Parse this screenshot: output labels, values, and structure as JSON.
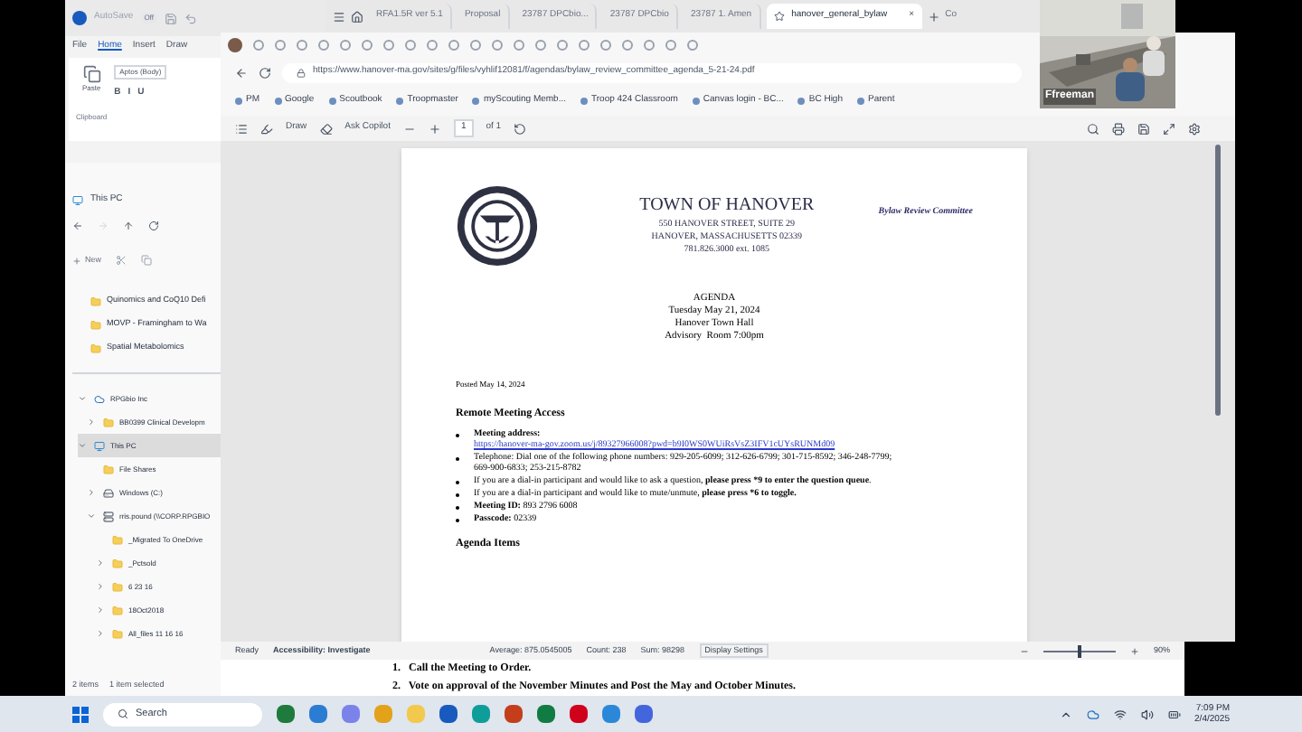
{
  "word": {
    "autosave": "AutoSave",
    "autosave_state": "Off",
    "ribbon_tabs": [
      {
        "label": "File",
        "selected": false
      },
      {
        "label": "Home",
        "selected": true
      },
      {
        "label": "Insert",
        "selected": false
      },
      {
        "label": "Draw",
        "selected": false
      }
    ],
    "paste": "Paste",
    "font": "Aptos (Body)",
    "format_buttons": [
      "B",
      "I",
      "U"
    ],
    "group": "Clipboard"
  },
  "browser": {
    "tabs": [
      {
        "label": "RFA1.5R ver 5.1",
        "selected": false
      },
      {
        "label": "Proposal",
        "selected": false
      },
      {
        "label": "23787 DPCbio...",
        "selected": false
      },
      {
        "label": "23787 DPCbio",
        "selected": false
      },
      {
        "label": "23787 1. Amen",
        "selected": false
      },
      {
        "label": "hanover_general_bylaw",
        "selected": true
      }
    ],
    "close": "×",
    "new_tab_label": "Co",
    "url": "https://www.hanover-ma.gov/sites/g/files/vyhlif12081/f/agendas/bylaw_review_committee_agenda_5-21-24.pdf",
    "bookmarks": [
      "PM",
      "Google",
      "Scoutbook",
      "Troopmaster",
      "myScouting Memb...",
      "Troop 424 Classroom",
      "Canvas login - BC...",
      "BC High",
      "Parent"
    ],
    "pdf_toolbar": {
      "draw": "Draw",
      "copilot": "Ask Copilot",
      "page": "1",
      "of": "of 1"
    }
  },
  "video": {
    "name": "Ffreeman"
  },
  "pdf": {
    "title": "TOWN OF HANOVER",
    "address": [
      "550 HANOVER STREET, SUITE 29",
      "HANOVER, MASSACHUSETTS 02339",
      "781.826.3000 ext. 1085"
    ],
    "committee": "Bylaw Review Committee",
    "agenda": [
      "AGENDA",
      "Tuesday May 21, 2024",
      "Hanover Town Hall",
      "Advisory  Room 7:00pm"
    ],
    "posted": "Posted May 14, 2024",
    "section": "Remote Meeting Access",
    "bullets": [
      {
        "kind": "link",
        "label": "Meeting address:",
        "link": "https://hanover-ma-gov.zoom.us/j/89327966008?pwd=b9I0WS0WUiRsVsZ3IFV1cUYsRUNMd09"
      },
      {
        "kind": "text",
        "text": "Telephone: Dial one of the following phone numbers: 929-205-6099; 312-626-6799; 301-715-8592; 346-248-7799; 669-900-6833; 253-215-8782"
      },
      {
        "kind": "text",
        "text": "If you are a dial-in participant and would like to ask a question, **please press *9 to enter the question queue**."
      },
      {
        "kind": "text",
        "text": "If you are a dial-in participant and would like to mute/unmute, **please press *6 to toggle.**"
      },
      {
        "kind": "text",
        "text": "**Meeting ID:** 893 2796 6008"
      },
      {
        "kind": "text",
        "text": "**Passcode:** 02339"
      }
    ],
    "items_heading": "Agenda Items"
  },
  "explorer": {
    "title": "This PC",
    "new": "New",
    "quick": [
      "Quinomics and CoQ10 Defi",
      "MOVP - Framingham to Wa",
      "Spatial Metabolomics"
    ],
    "tree": [
      {
        "label": "RPGbio Inc",
        "kind": "cloud",
        "expanded": true,
        "selected": false,
        "children": [
          {
            "label": "BB0399 Clinical Developm",
            "kind": "folder",
            "expanded": false,
            "selected": false
          }
        ]
      },
      {
        "label": "This PC",
        "kind": "pc",
        "expanded": true,
        "selected": true,
        "children": [
          {
            "label": "File Shares",
            "kind": "folder",
            "selected": false
          },
          {
            "label": "Windows (C:)",
            "kind": "drive",
            "expanded": false,
            "selected": false
          },
          {
            "label": "rris.pound (\\\\CORP.RPGBIO",
            "kind": "network",
            "expanded": true,
            "selected": false,
            "children": [
              {
                "label": "_Migrated To OneDrive",
                "kind": "folder",
                "selected": false
              },
              {
                "label": "_Pctsold",
                "kind": "folder",
                "expanded": false,
                "selected": false
              },
              {
                "label": "6 23 16",
                "kind": "folder",
                "expanded": false,
                "selected": false
              },
              {
                "label": "18Oct2018",
                "kind": "folder",
                "expanded": false,
                "selected": false
              },
              {
                "label": "All_files 11 16 16",
                "kind": "folder",
                "expanded": false,
                "selected": false
              }
            ]
          }
        ]
      }
    ],
    "status": [
      "2 items",
      "1 item selected"
    ]
  },
  "excel_status": {
    "ready": "Ready",
    "accessibility": "Accessibility: Investigate",
    "stats": [
      "Average: 875.0545005",
      "Count: 238",
      "Sum: 98298"
    ],
    "display": "Display Settings",
    "zoom": "90%",
    "zoom_slider": {
      "level": 0.5
    }
  },
  "word_doc": [
    "1.   Call the Meeting to Order.",
    "2.   Vote on approval of the November Minutes and Post the May and October Minutes."
  ],
  "taskbar": {
    "search": "Search",
    "time": "7:09 PM",
    "date": "2/4/2025"
  }
}
